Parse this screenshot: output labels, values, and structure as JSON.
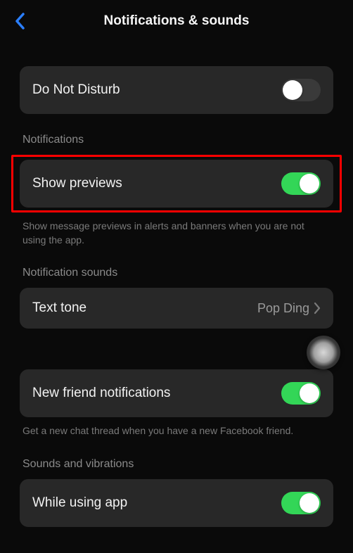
{
  "header": {
    "title": "Notifications & sounds"
  },
  "dnd": {
    "label": "Do Not Disturb",
    "enabled": false
  },
  "sections": {
    "notifications": {
      "header": "Notifications",
      "show_previews": {
        "label": "Show previews",
        "enabled": true
      },
      "desc": "Show message previews in alerts and banners when you are not using the app."
    },
    "notification_sounds": {
      "header": "Notification sounds",
      "text_tone": {
        "label": "Text tone",
        "value": "Pop Ding"
      }
    },
    "new_friend": {
      "label": "New friend notifications",
      "enabled": true,
      "desc": "Get a new chat thread when you have a new Facebook friend."
    },
    "sounds_vibrations": {
      "header": "Sounds and vibrations",
      "while_using": {
        "label": "While using app",
        "enabled": true
      }
    }
  }
}
